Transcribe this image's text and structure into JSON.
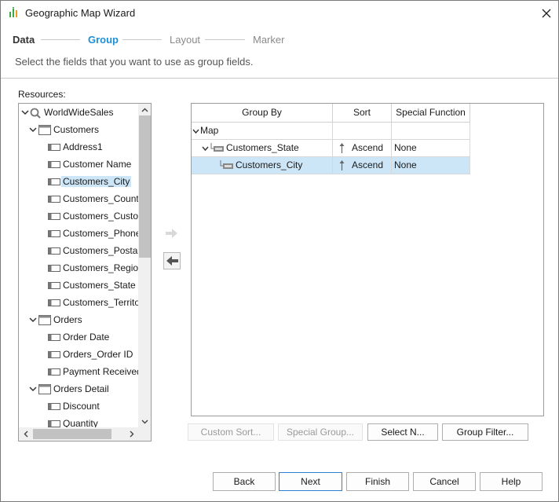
{
  "window": {
    "title": "Geographic Map Wizard",
    "app_icon": "chart-bars-icon",
    "close_icon": "close-icon"
  },
  "steps": [
    {
      "label": "Data",
      "state": "done"
    },
    {
      "label": "Group",
      "state": "active"
    },
    {
      "label": "Layout",
      "state": "pending"
    },
    {
      "label": "Marker",
      "state": "pending"
    }
  ],
  "subtitle": "Select the fields that you want to use as group fields.",
  "resources": {
    "label": "Resources:",
    "tree": [
      {
        "label": "WorldWideSales",
        "type": "query",
        "expanded": true
      },
      {
        "label": "Customers",
        "type": "table",
        "expanded": true
      },
      {
        "label": "Address1",
        "type": "field"
      },
      {
        "label": "Customer Name",
        "type": "field"
      },
      {
        "label": "Customers_City",
        "type": "field",
        "selected": true
      },
      {
        "label": "Customers_Country",
        "type": "field"
      },
      {
        "label": "Customers_Customer",
        "type": "field"
      },
      {
        "label": "Customers_Phone",
        "type": "field"
      },
      {
        "label": "Customers_Postal Code",
        "type": "field"
      },
      {
        "label": "Customers_Region",
        "type": "field"
      },
      {
        "label": "Customers_State",
        "type": "field"
      },
      {
        "label": "Customers_Territory",
        "type": "field"
      },
      {
        "label": "Orders",
        "type": "table",
        "expanded": true
      },
      {
        "label": "Order Date",
        "type": "field"
      },
      {
        "label": "Orders_Order ID",
        "type": "field"
      },
      {
        "label": "Payment Received",
        "type": "field"
      },
      {
        "label": "Orders Detail",
        "type": "table",
        "expanded": true
      },
      {
        "label": "Discount",
        "type": "field"
      },
      {
        "label": "Quantity",
        "type": "field"
      }
    ]
  },
  "group_table": {
    "columns": [
      "Group By",
      "Sort",
      "Special Function"
    ],
    "rows": [
      {
        "group_by": "Map",
        "sort": "",
        "special": ""
      },
      {
        "group_by": "Customers_State",
        "sort": "Ascend",
        "special": "None"
      },
      {
        "group_by": "Customers_City",
        "sort": "Ascend",
        "special": "None",
        "selected": true
      }
    ]
  },
  "group_buttons": {
    "custom_sort": "Custom Sort...",
    "special_group": "Special Group...",
    "select_n": "Select N...",
    "group_filter": "Group Filter..."
  },
  "footer": {
    "back": "Back",
    "next": "Next",
    "finish": "Finish",
    "cancel": "Cancel",
    "help": "Help"
  },
  "colors": {
    "accent": "#1e8fd6",
    "selection": "#cde6f7",
    "primary_border": "#2d7fd1"
  }
}
